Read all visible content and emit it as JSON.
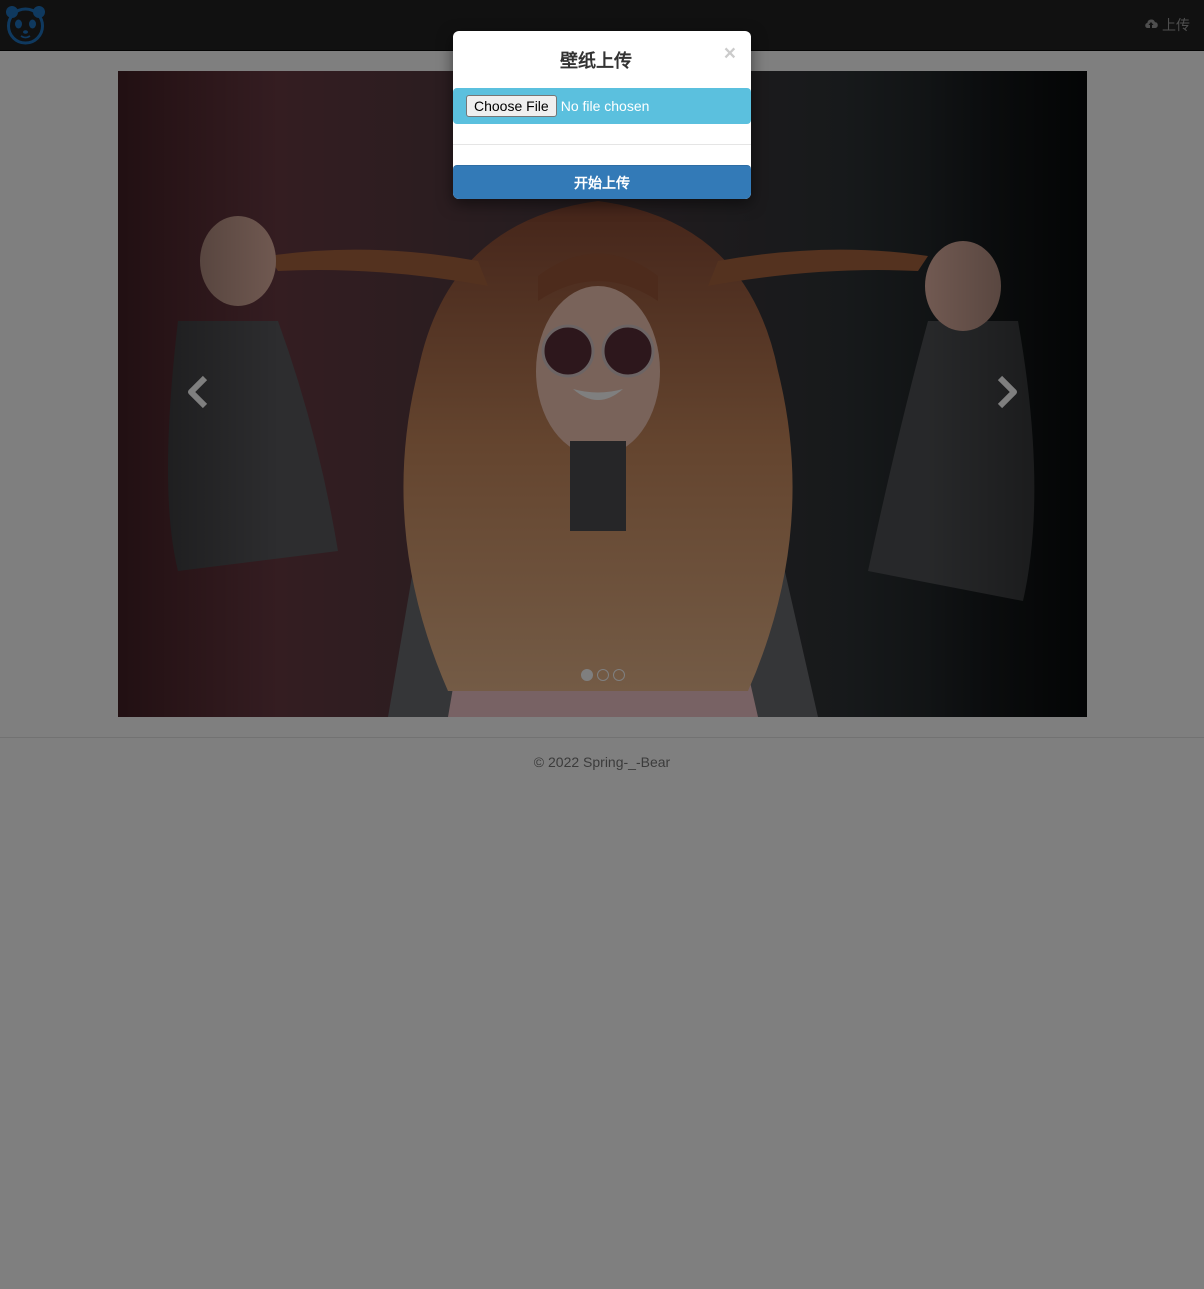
{
  "navbar": {
    "logo_icon": "panda-logo-icon",
    "upload_icon": "cloud-upload-icon",
    "upload_label": "上传"
  },
  "carousel": {
    "image_subject": "woman-with-long-hair-and-sunglasses",
    "prev_icon": "chevron-left-icon",
    "next_icon": "chevron-right-icon",
    "slide_count": 3,
    "active_slide": 1
  },
  "footer": {
    "text": "© 2022 Spring-_-Bear"
  },
  "modal": {
    "title": "壁纸上传",
    "close_label": "×",
    "choose_file_label": "Choose File",
    "file_status": "No file chosen",
    "submit_label": "开始上传"
  },
  "colors": {
    "navbar_bg": "#222222",
    "file_row_bg": "#5bc0de",
    "primary_button": "#337ab7",
    "logo_blue": "#1e73be"
  }
}
